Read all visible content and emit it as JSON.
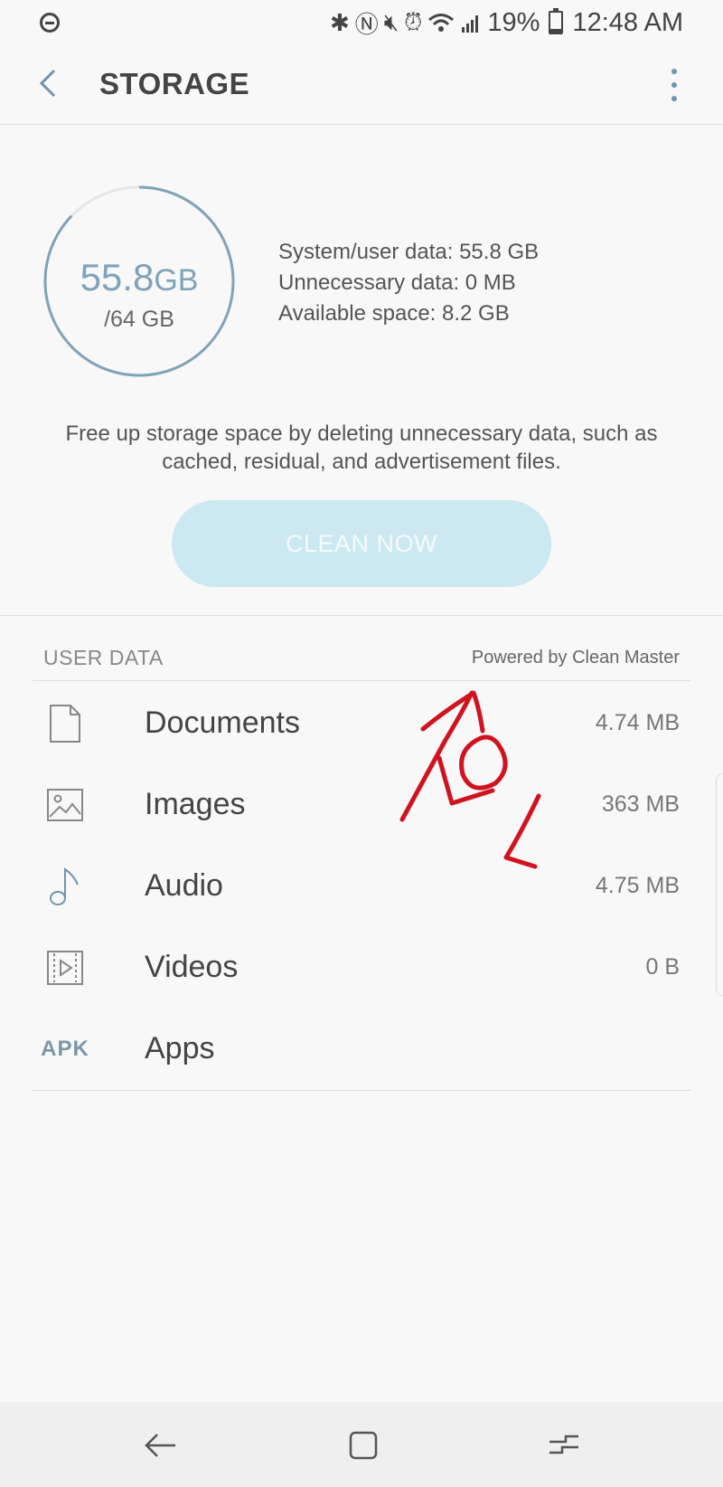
{
  "status_bar": {
    "battery": "19%",
    "time": "12:48 AM",
    "icons": [
      "do-not-disturb-icon",
      "bluetooth-icon",
      "nfc-icon",
      "mute-icon",
      "alarm-icon",
      "wifi-icon",
      "signal-icon",
      "battery-icon"
    ]
  },
  "app_bar": {
    "title": "STORAGE",
    "back_icon": "back-arrow-icon",
    "more_icon": "more-options-icon"
  },
  "storage": {
    "used_value": "55.8",
    "used_unit": "GB",
    "total": "/64 GB",
    "used_fraction": 0.872,
    "stats": [
      "System/user data: 55.8 GB",
      "Unnecessary data: 0 MB",
      "Available space: 8.2 GB"
    ]
  },
  "description": "Free up storage space by deleting unnecessary data, such as cached, residual, and advertisement files.",
  "clean_button": "CLEAN NOW",
  "section": {
    "title": "USER DATA",
    "powered_by": "Powered by Clean Master"
  },
  "items": [
    {
      "label": "Documents",
      "size": "4.74 MB",
      "icon": "document-icon"
    },
    {
      "label": "Images",
      "size": "363 MB",
      "icon": "image-icon"
    },
    {
      "label": "Audio",
      "size": "4.75 MB",
      "icon": "music-note-icon"
    },
    {
      "label": "Videos",
      "size": "0 B",
      "icon": "video-icon"
    },
    {
      "label": "Apps",
      "size": "",
      "icon": "APK"
    }
  ],
  "annotation": {
    "text": "LOL",
    "color": "#d0141f"
  },
  "colors": {
    "accent": "#6e95ae",
    "button_bg": "#cce8f1",
    "button_text": "#f4fbfd"
  }
}
